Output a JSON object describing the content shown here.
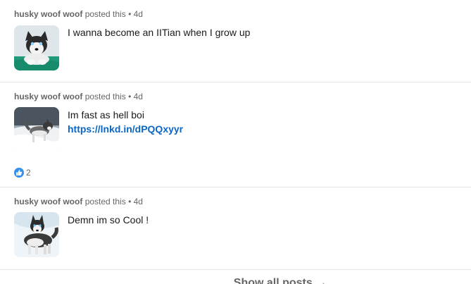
{
  "posts": [
    {
      "author": "husky woof woof",
      "action": "posted this",
      "separator": "•",
      "age": "4d",
      "text": "I wanna become an IITian when I grow up",
      "link": "",
      "image_icon": "husky-puppy-photo"
    },
    {
      "author": "husky woof woof",
      "action": "posted this",
      "separator": "•",
      "age": "4d",
      "text": "Im fast as hell boi",
      "link": "https://lnkd.in/dPQQxyyr",
      "image_icon": "husky-running-snow-photo",
      "reactions": {
        "icon": "like-icon",
        "count": "2",
        "color": "#378fe9"
      }
    },
    {
      "author": "husky woof woof",
      "action": "posted this",
      "separator": "•",
      "age": "4d",
      "text": "Demn im so Cool !",
      "link": "",
      "image_icon": "husky-standing-photo"
    }
  ],
  "footer": {
    "show_all_label": "Show all posts",
    "arrow_icon": "arrow-right-icon"
  },
  "colors": {
    "link": "#0a66c2",
    "meta": "#666666",
    "divider": "#e5e5e5"
  }
}
